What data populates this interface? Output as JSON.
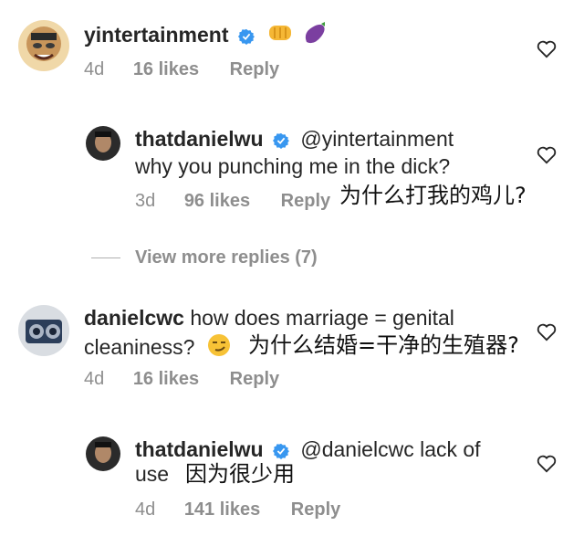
{
  "comments": [
    {
      "username": "yintertainment",
      "emojis": [
        "fist-emoji",
        "eggplant-emoji"
      ],
      "age": "4d",
      "likes": "16 likes",
      "reply": "Reply"
    },
    {
      "username": "thatdanielwu",
      "mention": "@yintertainment",
      "text": "why you punching me in the dick?",
      "translation": "为什么打我的鸡儿?",
      "age": "3d",
      "likes": "96 likes",
      "reply": "Reply"
    },
    {
      "username": "danielcwc",
      "text_line1": "how does marriage = genital",
      "text_line2": "cleaniness?",
      "emoji": "smirk-emoji",
      "translation": "为什么结婚=干净的生殖器?",
      "age": "4d",
      "likes": "16 likes",
      "reply": "Reply"
    },
    {
      "username": "thatdanielwu",
      "mention": "@danielcwc",
      "text_line1": "lack of",
      "text_line2": "use",
      "translation": "因为很少用",
      "age": "4d",
      "likes": "141 likes",
      "reply": "Reply"
    }
  ],
  "view_more": "View more replies (7)",
  "colors": {
    "text": "#262626",
    "muted": "#8e8e8e",
    "verified": "#3897f0"
  }
}
